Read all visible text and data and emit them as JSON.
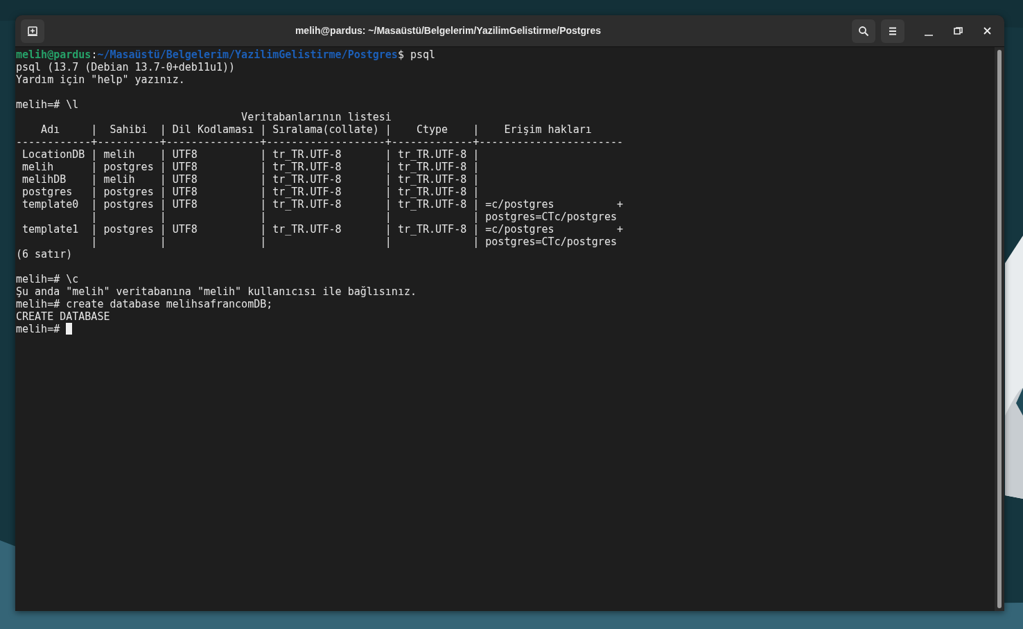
{
  "window": {
    "title": "melih@pardus: ~/Masaüstü/Belgelerim/YazilimGelistirme/Postgres"
  },
  "terminal": {
    "lines": [
      {
        "kind": "prompt",
        "user": "melih@pardus",
        "separator": ":",
        "path": "~/Masaüstü/Belgelerim/YazilimGelistirme/Postgres",
        "command": "$ psql"
      },
      {
        "kind": "text",
        "text": "psql (13.7 (Debian 13.7-0+deb11u1))"
      },
      {
        "kind": "text",
        "text": "Yardım için \"help\" yazınız."
      },
      {
        "kind": "blank"
      },
      {
        "kind": "text",
        "text": "melih=# \\l"
      },
      {
        "kind": "text",
        "text": "                                    Veritabanlarının listesi"
      },
      {
        "kind": "text",
        "text": "    Adı     |  Sahibi  | Dil Kodlaması | Sıralama(collate) |    Ctype    |    Erişim hakları"
      },
      {
        "kind": "text",
        "text": "------------+----------+---------------+-------------------+-------------+-----------------------"
      },
      {
        "kind": "text",
        "text": " LocationDB | melih    | UTF8          | tr_TR.UTF-8       | tr_TR.UTF-8 |"
      },
      {
        "kind": "text",
        "text": " melih      | postgres | UTF8          | tr_TR.UTF-8       | tr_TR.UTF-8 |"
      },
      {
        "kind": "text",
        "text": " melihDB    | melih    | UTF8          | tr_TR.UTF-8       | tr_TR.UTF-8 |"
      },
      {
        "kind": "text",
        "text": " postgres   | postgres | UTF8          | tr_TR.UTF-8       | tr_TR.UTF-8 |"
      },
      {
        "kind": "text",
        "text": " template0  | postgres | UTF8          | tr_TR.UTF-8       | tr_TR.UTF-8 | =c/postgres          +"
      },
      {
        "kind": "text",
        "text": "            |          |               |                   |             | postgres=CTc/postgres"
      },
      {
        "kind": "text",
        "text": " template1  | postgres | UTF8          | tr_TR.UTF-8       | tr_TR.UTF-8 | =c/postgres          +"
      },
      {
        "kind": "text",
        "text": "            |          |               |                   |             | postgres=CTc/postgres"
      },
      {
        "kind": "text",
        "text": "(6 satır)"
      },
      {
        "kind": "blank"
      },
      {
        "kind": "text",
        "text": "melih=# \\c"
      },
      {
        "kind": "text",
        "text": "Şu anda \"melih\" veritabanına \"melih\" kullanıcısı ile bağlısınız."
      },
      {
        "kind": "text",
        "text": "melih=# create database melihsafrancomDB;"
      },
      {
        "kind": "text",
        "text": "CREATE DATABASE"
      },
      {
        "kind": "cursor",
        "text": "melih=#"
      }
    ]
  }
}
